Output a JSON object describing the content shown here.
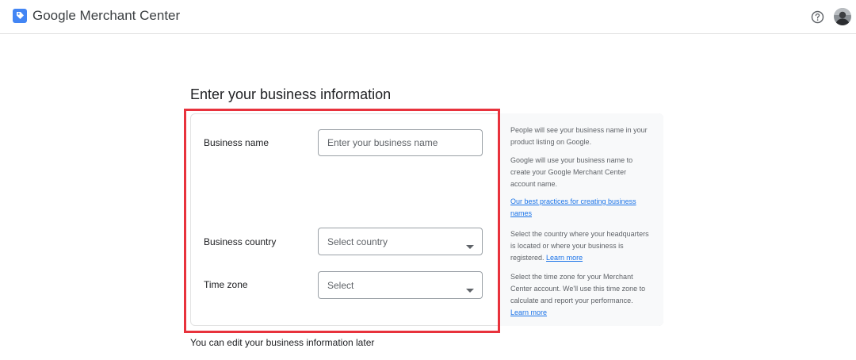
{
  "app": {
    "title": "Google Merchant Center"
  },
  "header": {
    "help_icon": "help-circle-icon",
    "avatar": "user-avatar"
  },
  "page": {
    "title": "Enter your business information",
    "footnote": "You can edit your business information later"
  },
  "form": {
    "business_name": {
      "label": "Business name",
      "placeholder": "Enter your business name",
      "value": ""
    },
    "business_country": {
      "label": "Business country",
      "selected": "Select country"
    },
    "time_zone": {
      "label": "Time zone",
      "selected": "Select"
    }
  },
  "help": {
    "name_visibility": "People will see your business name in your product listing on Google.",
    "name_account": "Google will use your business name to create your Google Merchant Center account name.",
    "best_practices_link": "Our best practices for creating business names",
    "country_text": "Select the country where your headquarters is located or where your business is registered.",
    "country_link": "Learn more",
    "timezone_text": "Select the time zone for your Merchant Center account. We'll use this time zone to calculate and report your performance.",
    "timezone_link": "Learn more"
  },
  "colors": {
    "highlight": "#e8323c",
    "link": "#1a73e8",
    "logo_blue": "#4285f4"
  }
}
